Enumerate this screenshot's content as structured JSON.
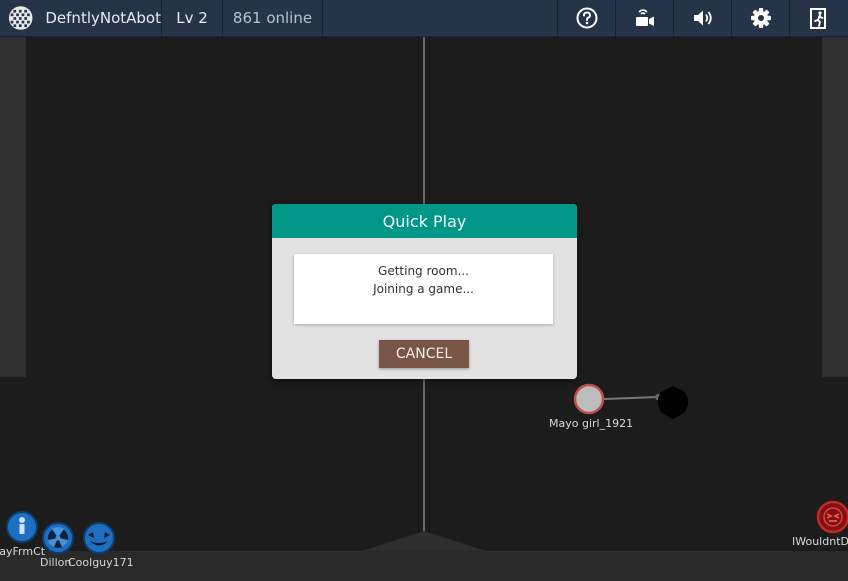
{
  "topbar": {
    "username": "DefntlyNotAbot",
    "level": "Lv 2",
    "online": "861 online",
    "buttons": [
      {
        "icon": "help-icon"
      },
      {
        "icon": "camera-icon"
      },
      {
        "icon": "volume-icon"
      },
      {
        "icon": "gear-icon"
      },
      {
        "icon": "exit-icon"
      }
    ]
  },
  "dialog": {
    "title": "Quick Play",
    "line1": "Getting room...",
    "line2": "Joining a game...",
    "cancel_label": "CANCEL"
  },
  "players": [
    {
      "name": "Mayo girl_1921"
    },
    {
      "name": "JayFrmCt"
    },
    {
      "name": "Dillon"
    },
    {
      "name": "Coolguy171"
    },
    {
      "name": "IWouldntDo"
    }
  ],
  "colors": {
    "topbar": "#26344a",
    "dialog_header": "#009688",
    "cancel_button": "#795548",
    "blue_team": "#1e88e5",
    "red_team": "#c62828"
  }
}
